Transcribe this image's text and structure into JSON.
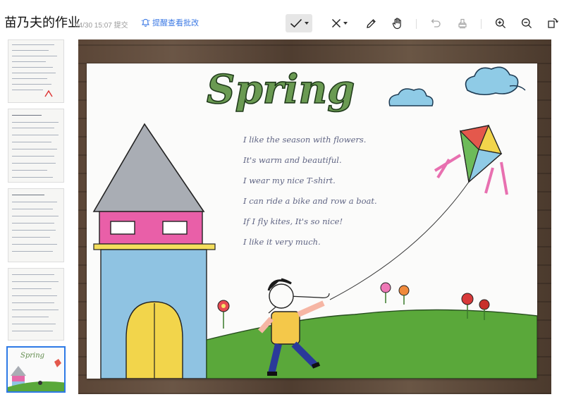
{
  "header": {
    "title": "苗乃夫的作业",
    "submit_time": "04/30 15:07",
    "submit_label": "提交",
    "remind_label": "提醒查看批改"
  },
  "toolbar": {
    "tools": [
      "check-icon",
      "cross-icon",
      "pencil-icon",
      "hand-icon",
      "undo-icon",
      "stamp-icon",
      "zoom-in-icon",
      "zoom-out-icon",
      "rotate-icon"
    ]
  },
  "thumbnails": {
    "count": 5,
    "active_index": 5
  },
  "drawing": {
    "heading": "Spring",
    "poem": [
      "I like the season with flowers.",
      "It's warm and beautiful.",
      "I wear my nice T-shirt.",
      "I can ride a bike and row a boat.",
      "If I fly kites, It's so nice!",
      "I like it very much."
    ]
  },
  "colors": {
    "accent": "#2e7ae6",
    "link": "#3a78e4"
  }
}
